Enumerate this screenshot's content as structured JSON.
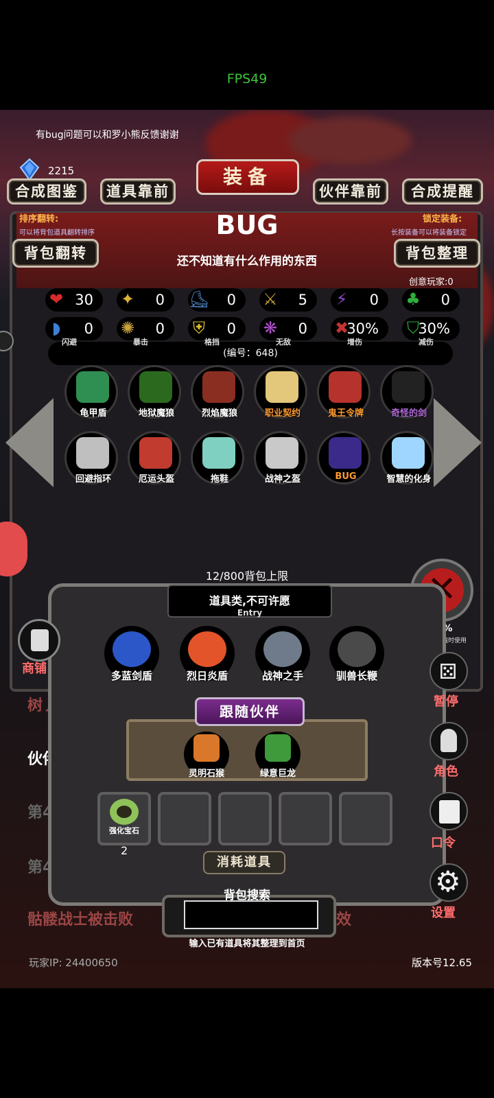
{
  "fps": "FPS49",
  "feedback": "有bug问题可以和罗小熊反馈谢谢",
  "currency": {
    "count": "2215"
  },
  "tabs": {
    "recipe_book": "合成图鉴",
    "items_front": "道具靠前",
    "title": "装备",
    "partner_front": "伙伴靠前",
    "craft_reminder": "合成提醒"
  },
  "sort_flip": {
    "label": "排序翻转:",
    "hint": "可以将背包道具翻转排序",
    "button": "背包翻转"
  },
  "lock_equip": {
    "label": "锁定装备:",
    "hint": "长按装备可以将装备锁定",
    "button": "背包整理"
  },
  "item": {
    "name": "BUG",
    "description": "还不知道有什么作用的东西",
    "code": "(编号：648)"
  },
  "creative_player": "创意玩家:0",
  "stats": [
    {
      "icon": "heart-icon",
      "value": "30",
      "label": "",
      "color": "#d62b2b",
      "glyph": "❤"
    },
    {
      "icon": "strength-icon",
      "value": "0",
      "label": "",
      "color": "#d9b23a",
      "glyph": "✦"
    },
    {
      "icon": "boot-icon",
      "value": "0",
      "label": "",
      "color": "#4a7fc0",
      "glyph": "⛸"
    },
    {
      "icon": "sword-attack-icon",
      "value": "5",
      "label": "",
      "color": "#c9a13a",
      "glyph": "⚔"
    },
    {
      "icon": "lightning-icon",
      "value": "0",
      "label": "",
      "color": "#8b4ac7",
      "glyph": "⚡"
    },
    {
      "icon": "clover-icon",
      "value": "0",
      "label": "",
      "color": "#2fae3c",
      "glyph": "♣"
    },
    {
      "icon": "dodge-icon",
      "value": "0",
      "label": "闪避",
      "color": "#3d7fd6",
      "glyph": "◗"
    },
    {
      "icon": "critical-icon",
      "value": "0",
      "label": "暴击",
      "color": "#c8a23c",
      "glyph": "✺"
    },
    {
      "icon": "block-shield-icon",
      "value": "0",
      "label": "格挡",
      "color": "#e1c531",
      "glyph": "⛨"
    },
    {
      "icon": "invincible-wings-icon",
      "value": "0",
      "label": "无敌",
      "color": "#b24fd0",
      "glyph": "❋"
    },
    {
      "icon": "damage-boost-icon",
      "value": "30%",
      "label": "增伤",
      "color": "#c53333",
      "glyph": "✖"
    },
    {
      "icon": "damage-reduce-icon",
      "value": "30%",
      "label": "减伤",
      "color": "#2fae3c",
      "glyph": "⛉"
    }
  ],
  "inventory": [
    {
      "name": "龟甲盾",
      "icon": "turtle-shield-icon",
      "color": "#ffffff",
      "pic": "#2f8f52"
    },
    {
      "name": "地狱魔狼",
      "icon": "hell-wolf-icon",
      "color": "#ffffff",
      "pic": "#2b6a1e"
    },
    {
      "name": "烈焰魔狼",
      "icon": "flame-wolf-icon",
      "color": "#ffffff",
      "pic": "#8a2e22"
    },
    {
      "name": "职业契约",
      "icon": "contract-scroll-icon",
      "color": "#ff9a2e",
      "pic": "#e3c77a"
    },
    {
      "name": "鬼王令牌",
      "icon": "ghost-king-token-icon",
      "color": "#ff9a2e",
      "pic": "#b6322c"
    },
    {
      "name": "奇怪的剑",
      "icon": "strange-sword-icon",
      "color": "#b06ad8",
      "pic": "#222222"
    },
    {
      "name": "回避指环",
      "icon": "evasion-ring-icon",
      "color": "#ffffff",
      "pic": "#bfbfbf"
    },
    {
      "name": "厄运头盔",
      "icon": "doom-helmet-icon",
      "color": "#ffffff",
      "pic": "#c23b2f"
    },
    {
      "name": "拖鞋",
      "icon": "slipper-icon",
      "color": "#ffffff",
      "pic": "#7fd0c0"
    },
    {
      "name": "战神之盔",
      "icon": "war-god-helmet-icon",
      "color": "#ffffff",
      "pic": "#c9c9c9"
    },
    {
      "name": "BUG",
      "icon": "bug-item-icon",
      "color": "#ff9a2e",
      "pic": "#3b2a8a"
    },
    {
      "name": "智慧的化身",
      "icon": "wisdom-avatar-icon",
      "color": "#ffffff",
      "pic": "#9fd6ff"
    }
  ],
  "capacity": "12/800背包上限",
  "wish": {
    "title": "道具类,不可许愿",
    "subtitle": "Entry"
  },
  "equipped": [
    {
      "name": "多蓝剑盾",
      "icon": "blue-sword-shield-icon",
      "pic": "#2c57c8"
    },
    {
      "name": "烈日炎盾",
      "icon": "sun-flame-shield-icon",
      "pic": "#e4542a"
    },
    {
      "name": "战神之手",
      "icon": "war-god-hand-icon",
      "pic": "#6f7a8a"
    },
    {
      "name": "驯兽长鞭",
      "icon": "beast-whip-icon",
      "pic": "#4a4a4a"
    }
  ],
  "partner_title": "跟随伙伴",
  "partners": [
    {
      "name": "灵明石猴",
      "icon": "stone-monkey-icon",
      "pic": "#d9782a"
    },
    {
      "name": "绿意巨龙",
      "icon": "green-dragon-icon",
      "pic": "#3e9a3a"
    }
  ],
  "consumables": [
    {
      "name": "强化宝石",
      "count": "2",
      "icon": "enhance-gem-icon"
    }
  ],
  "consume_label": "消耗道具",
  "search": {
    "label": "背包搜索",
    "hint": "输入已有道具将其整理到首页"
  },
  "side_menu": {
    "shop": "商铺",
    "pause": "暂停",
    "role": "角色",
    "command": "口令",
    "settings": "设置"
  },
  "background": {
    "text_tree": "树丿",
    "text_partner": "伙伴",
    "text_4a": "第4",
    "text_4b": "第4",
    "defeat": "骷髅战士被击败",
    "defeat_tail": "效",
    "small_pct": "00%",
    "small_hint": "其数值时使用"
  },
  "player_ip": "玩家IP:  24400650",
  "version": "版本号12.65"
}
